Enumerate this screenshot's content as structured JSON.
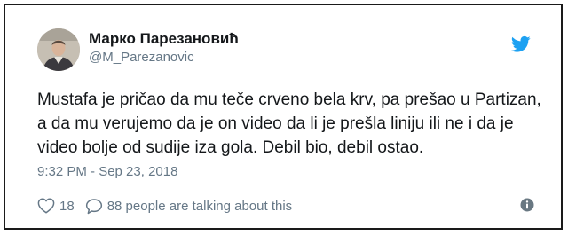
{
  "author": {
    "name": "Марко Парезановић",
    "handle": "@M_Parezanovic",
    "avatar_icon": "user-avatar"
  },
  "brand": {
    "icon": "twitter-bird-icon",
    "color": "#1da1f2"
  },
  "tweet": {
    "text": "Mustafa je pričao da mu teče crveno bela krv, pa prešao u Partizan, a da mu verujemo da je on video da li je prešla liniju ili ne i da je video bolje od sudije iza gola. Debil bio, debil ostao.",
    "timestamp": "9:32 PM - Sep 23, 2018"
  },
  "actions": {
    "like_count": "18",
    "like_icon": "heart-icon",
    "reply_text": "88 people are talking about this",
    "reply_icon": "speech-bubble-icon",
    "info_icon": "info-icon"
  },
  "colors": {
    "text": "#14171a",
    "muted": "#657786"
  }
}
